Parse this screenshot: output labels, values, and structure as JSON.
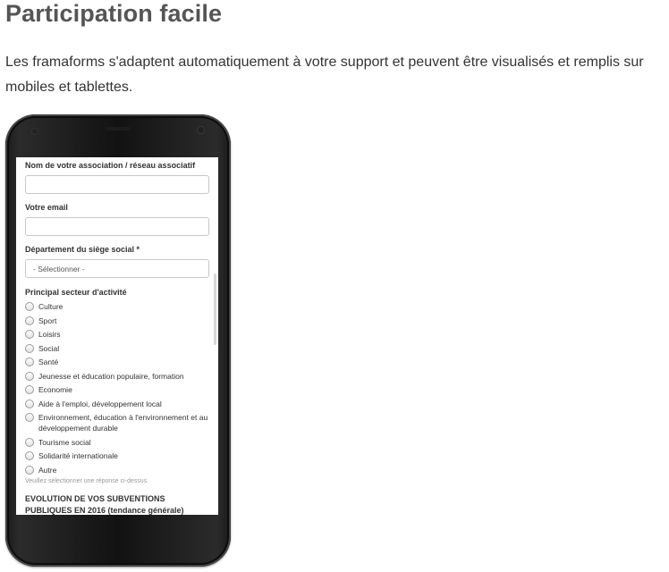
{
  "header": {
    "title": "Participation facile",
    "intro_line1": "Les framaforms s'adaptent automatiquement à votre support et peuvent être visualisés et remplis sur",
    "intro_line2": "mobiles et tablettes."
  },
  "form": {
    "association_label": "Nom de votre association / réseau associatif",
    "association_value": "",
    "email_label": "Votre email",
    "email_value": "",
    "department_label": "Département du siège social *",
    "department_selected": "- Sélectionner -",
    "sector_label": "Principal secteur d'activité",
    "sector_options": [
      "Culture",
      "Sport",
      "Loisirs",
      "Social",
      "Santé",
      "Jeunesse et éducation populaire, formation",
      "Economie",
      "Aide à l'emploi, développement local",
      "Environnement, éducation à l'environnement et au développement durable",
      "Tourisme social",
      "Solidarité internationale",
      "Autre"
    ],
    "sector_hint": "Veuillez sélectionner une réponse ci-dessus",
    "subsidies_title": "EVOLUTION DE VOS SUBVENTIONS PUBLIQUES EN 2016 (tendance générale)"
  }
}
